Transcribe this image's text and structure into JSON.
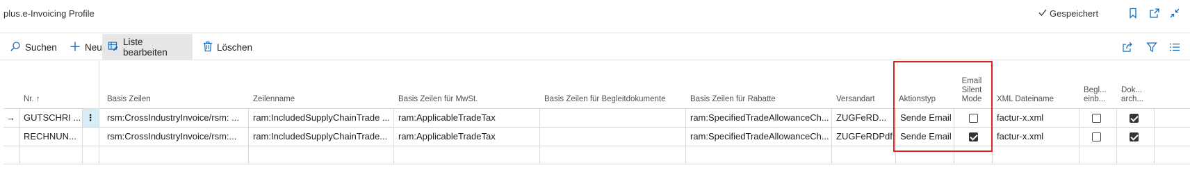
{
  "header": {
    "title": "plus.e-Invoicing Profile",
    "saved_label": "Gespeichert",
    "icons": [
      "bookmark-icon",
      "open-new-window-icon",
      "collapse-icon"
    ]
  },
  "actions": {
    "search": "Suchen",
    "new": "Neu",
    "edit_list": "Liste bearbeiten",
    "delete": "Löschen"
  },
  "columns": {
    "nr": "Nr. ↑",
    "basis_zeilen": "Basis Zeilen",
    "zeilenname": "Zeilenname",
    "basis_mwst": "Basis Zeilen für MwSt.",
    "basis_begleit": "Basis Zeilen für Begleitdokumente",
    "basis_rabatte": "Basis Zeilen für Rabatte",
    "versandart": "Versandart",
    "aktionstyp": "Aktionstyp",
    "email_silent_1": "Email",
    "email_silent_2": "Silent",
    "email_silent_3": "Mode",
    "xml_dateiname": "XML Dateiname",
    "begl_1": "Begl...",
    "begl_2": "einb...",
    "dok_1": "Dok...",
    "dok_2": "arch..."
  },
  "rows": [
    {
      "nr": "GUTSCHRI ...",
      "basis_zeilen": "rsm:CrossIndustryInvoice/rsm: ...",
      "zeilenname": "ram:IncludedSupplyChainTrade ...",
      "basis_mwst": "ram:ApplicableTradeTax",
      "basis_begleit": "",
      "basis_rabatte": "ram:SpecifiedTradeAllowanceCh...",
      "versandart": "ZUGFeRD...",
      "aktionstyp": "Sende Email",
      "email_silent": false,
      "xml_dateiname": "factur-x.xml",
      "begl": false,
      "dok": true
    },
    {
      "nr": "RECHNUN...",
      "basis_zeilen": "rsm:CrossIndustryInvoice/rsm:...",
      "zeilenname": "ram:IncludedSupplyChainTrade...",
      "basis_mwst": "ram:ApplicableTradeTax",
      "basis_begleit": "",
      "basis_rabatte": "ram:SpecifiedTradeAllowanceCh...",
      "versandart": "ZUGFeRDPdf",
      "aktionstyp": "Sende Email",
      "email_silent": true,
      "xml_dateiname": "factur-x.xml",
      "begl": false,
      "dok": true
    }
  ],
  "colors": {
    "highlight": "#e02020",
    "selected_cell": "#d6eef5",
    "accent": "#0f6cbd"
  }
}
